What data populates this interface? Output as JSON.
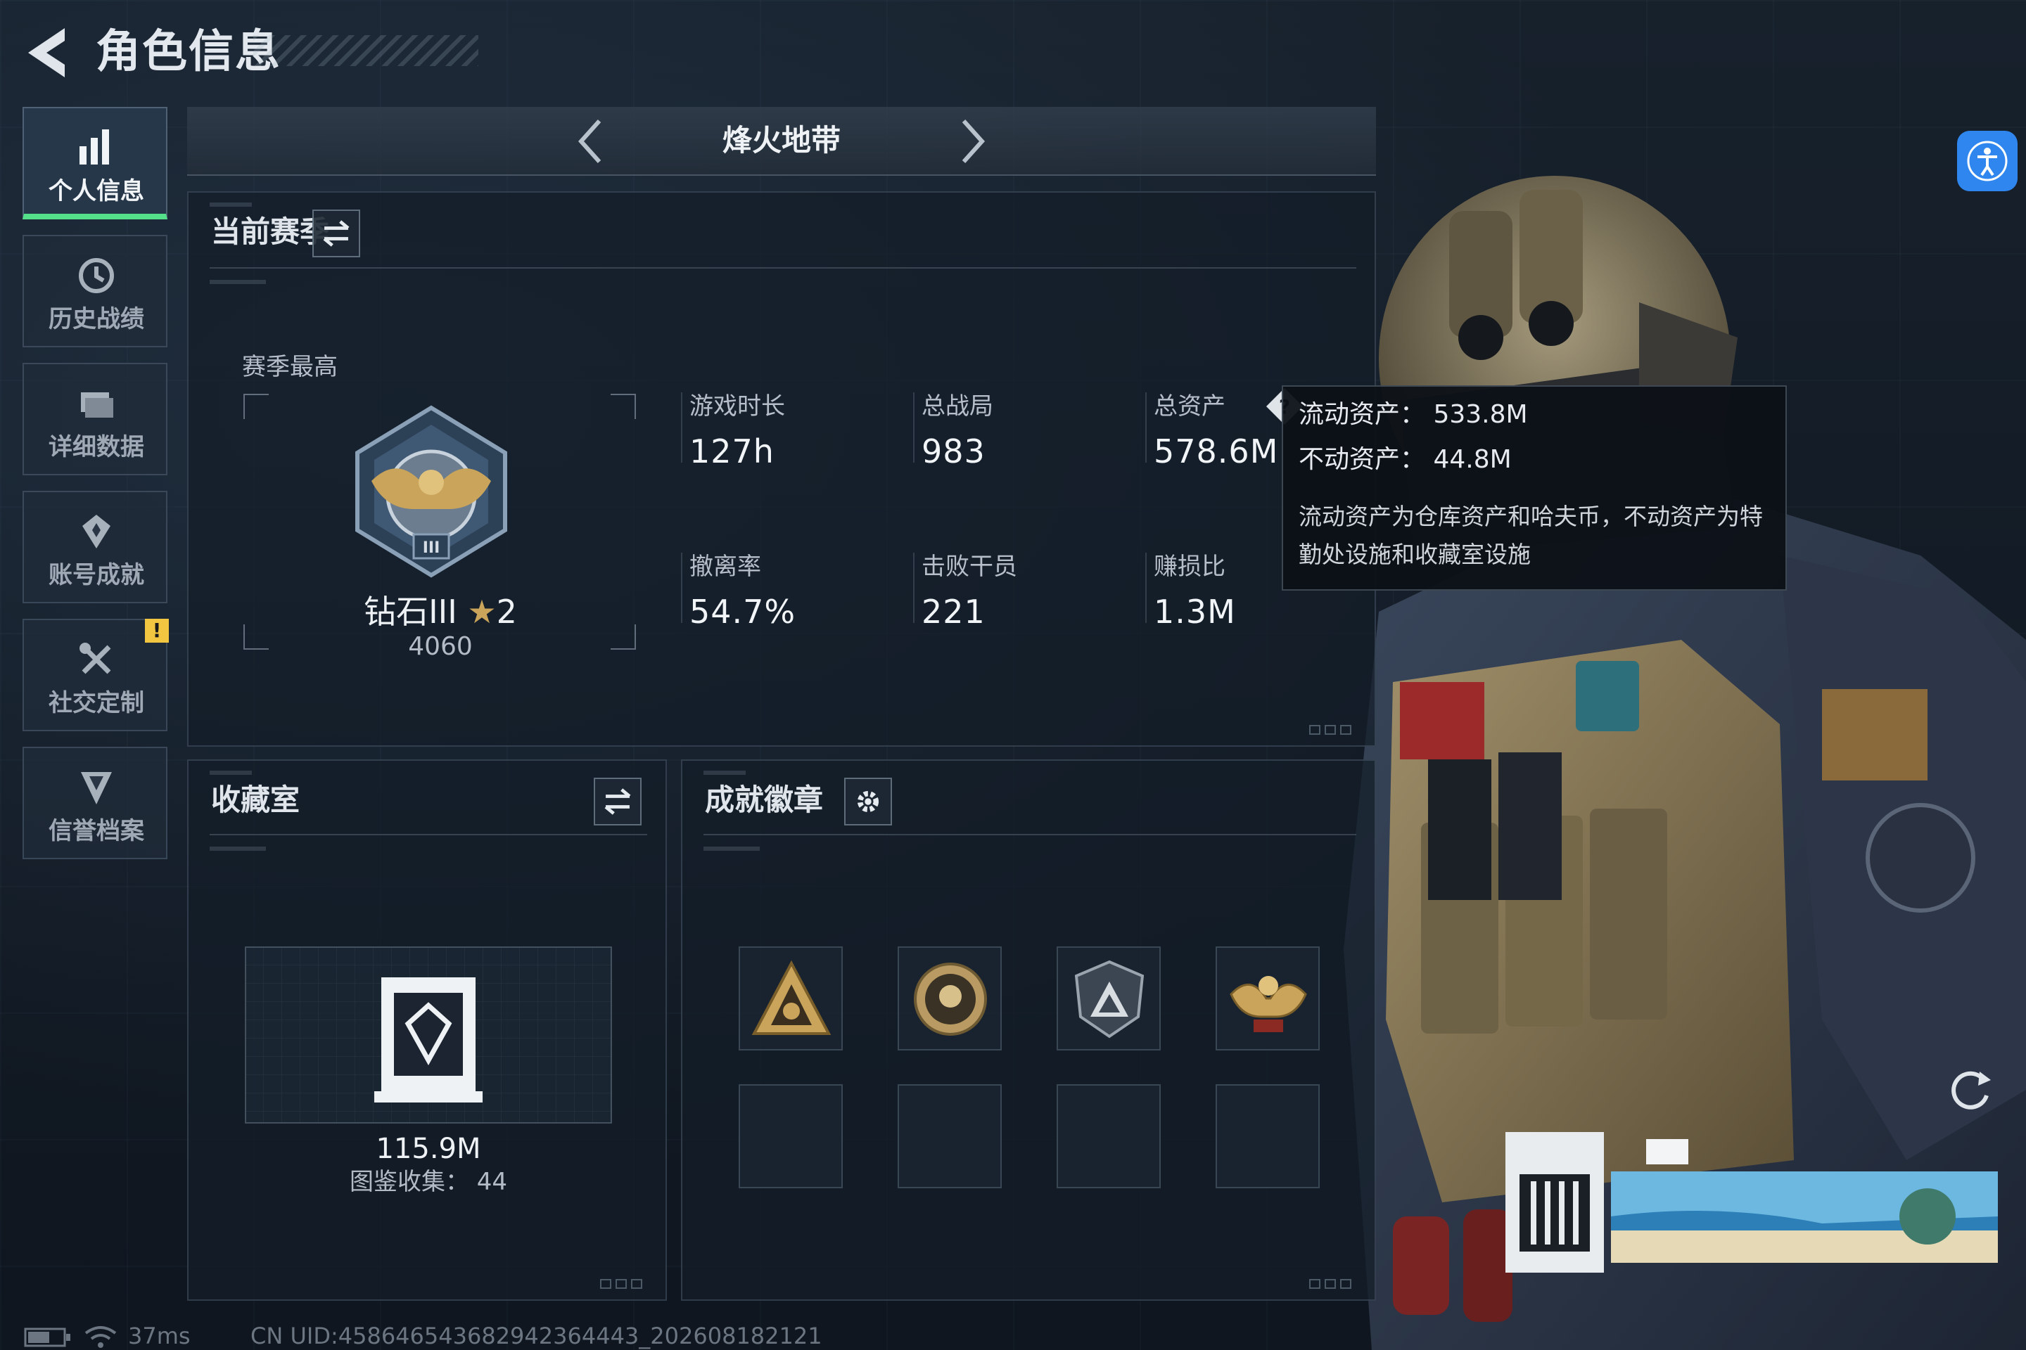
{
  "header": {
    "title": "角色信息",
    "mode": "烽火地带"
  },
  "sidebar": {
    "items": [
      {
        "label": "个人信息",
        "icon": "bar-chart-icon",
        "active": true
      },
      {
        "label": "历史战绩",
        "icon": "history-clock-icon",
        "active": false
      },
      {
        "label": "详细数据",
        "icon": "data-folder-icon",
        "active": false
      },
      {
        "label": "账号成就",
        "icon": "achievement-star-icon",
        "active": false
      },
      {
        "label": "社交定制",
        "icon": "tools-icon",
        "active": false,
        "badge": "!"
      },
      {
        "label": "信誉档案",
        "icon": "shield-v-icon",
        "active": false
      }
    ]
  },
  "season": {
    "title": "当前赛季",
    "best_label": "赛季最高",
    "rank_name": "钻石III",
    "rank_stars": "2",
    "rank_points": "4060",
    "stats": [
      {
        "label": "游戏时长",
        "value": "127h"
      },
      {
        "label": "总战局",
        "value": "983"
      },
      {
        "label": "总资产",
        "value": "578.6M",
        "help": true
      },
      {
        "label": "撤离率",
        "value": "54.7%"
      },
      {
        "label": "击败干员",
        "value": "221"
      },
      {
        "label": "赚损比",
        "value": "1.3M"
      }
    ]
  },
  "tooltip": {
    "liquid": "流动资产：  533.8M",
    "fixed": "不动资产：  44.8M",
    "description": "流动资产为仓库资产和哈夫币，不动资产为特勤处设施和收藏室设施"
  },
  "collection": {
    "title": "收藏室",
    "value": "115.9M",
    "catalog": "图鉴收集：  44"
  },
  "achievements": {
    "title": "成就徽章",
    "filled_slots": 4,
    "empty_slots": 4
  },
  "status_bar": {
    "ping": "37ms",
    "uid": "CN UID:458646543682942364443_202608182121"
  },
  "colors": {
    "accent_green": "#54e08a",
    "warn_yellow": "#f2c640",
    "access_blue": "#2f86ee",
    "gold": "#c9a45a"
  }
}
